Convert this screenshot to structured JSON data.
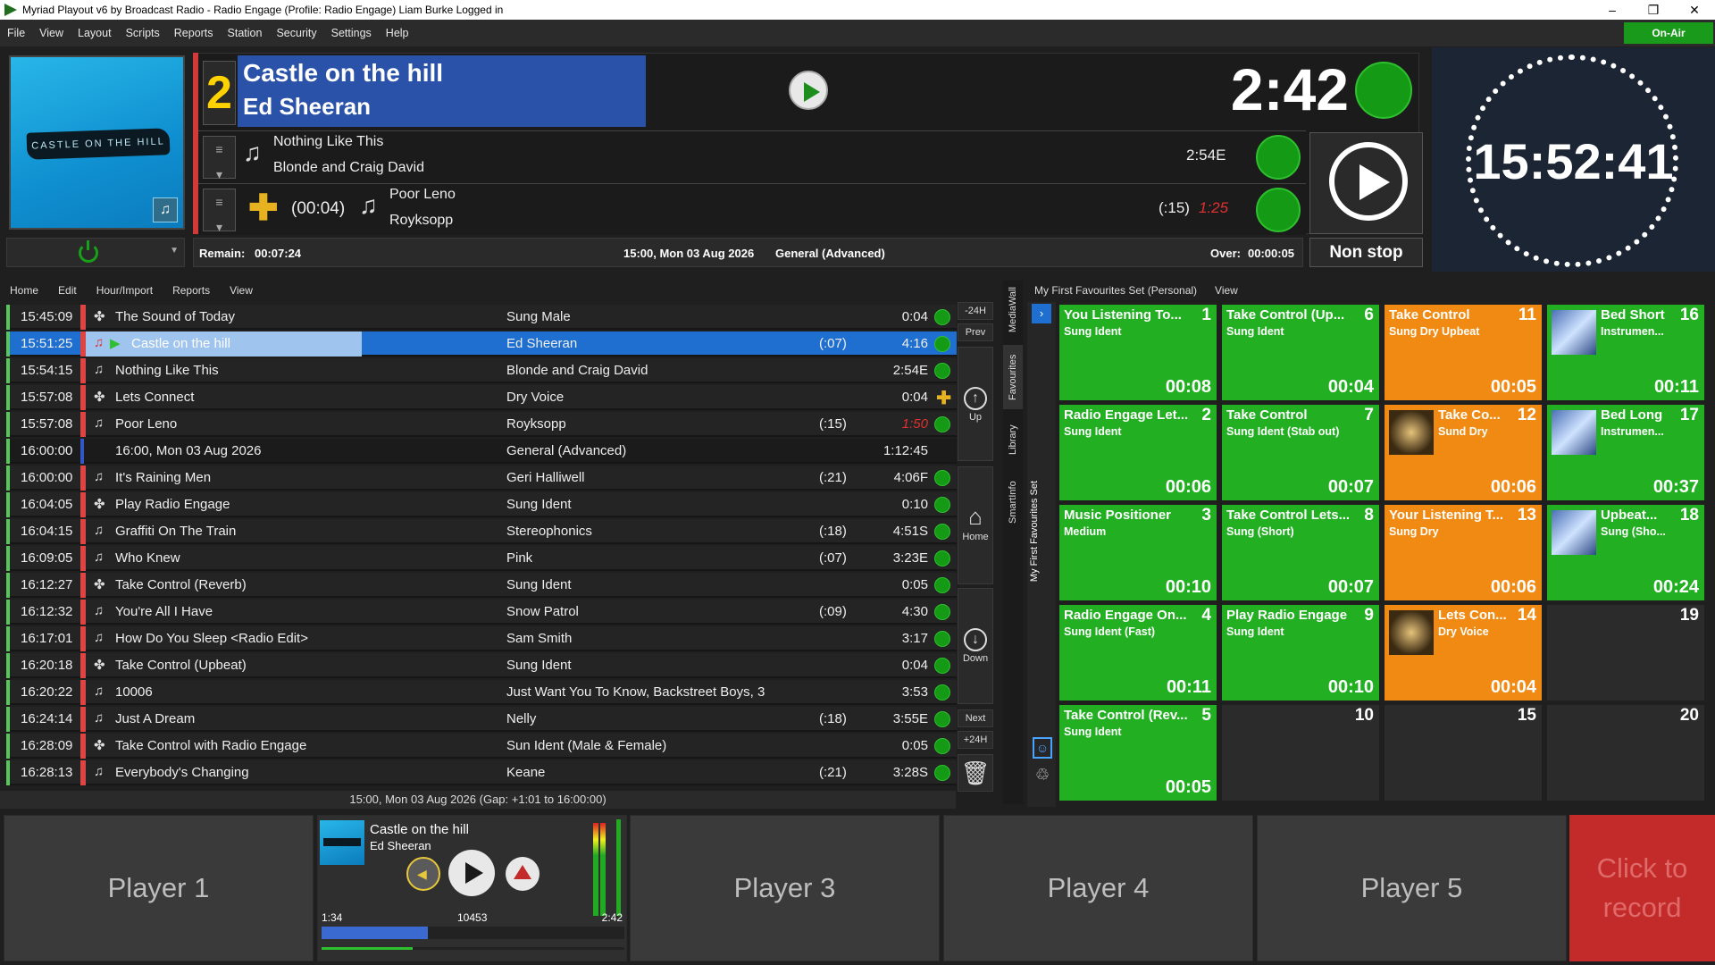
{
  "window": {
    "title": "Myriad Playout v6 by Broadcast Radio - Radio Engage (Profile: Radio Engage) Liam Burke Logged in"
  },
  "menu": [
    "File",
    "View",
    "Layout",
    "Scripts",
    "Reports",
    "Station",
    "Security",
    "Settings",
    "Help"
  ],
  "onair_label": "On-Air",
  "artwork": {
    "text": "CASTLE ON THE HILL"
  },
  "now": {
    "number": "2",
    "title": "Castle on the hill",
    "artist": "Ed Sheeran",
    "countdown": "2:42"
  },
  "next1": {
    "title": "Nothing Like This",
    "artist": "Blonde and Craig David",
    "duration": "2:54E"
  },
  "next2": {
    "intro": "(00:04)",
    "title": "Poor Leno",
    "artist": "Royksopp",
    "intro2": "(:15)",
    "duration": "1:25"
  },
  "info": {
    "remain_label": "Remain:",
    "remain": "00:07:24",
    "date": "15:00, Mon 03 Aug 2026",
    "category": "General (Advanced)",
    "over_label": "Over:",
    "over": "00:00:05"
  },
  "nonstop": "Non stop",
  "clock": "15:52:41",
  "logmenu": [
    "Home",
    "Edit",
    "Hour/Import",
    "Reports",
    "View"
  ],
  "log": [
    {
      "time": "15:45:09",
      "icon": "jingle-icon",
      "title": "The Sound of Today",
      "artist": "Sung Male",
      "intro": "",
      "dur": "0:04",
      "state": "dot"
    },
    {
      "time": "15:51:25",
      "icon": "playing",
      "title": "Castle on the hill",
      "artist": "Ed Sheeran",
      "intro": "(:07)",
      "dur": "4:16",
      "state": "dot"
    },
    {
      "time": "15:54:15",
      "icon": "note",
      "title": "Nothing Like This",
      "artist": "Blonde and Craig David",
      "intro": "",
      "dur": "2:54E",
      "state": "dot"
    },
    {
      "time": "15:57:08",
      "icon": "jingle-icon",
      "title": "Lets Connect",
      "artist": "Dry Voice",
      "intro": "",
      "dur": "0:04",
      "state": "plus"
    },
    {
      "time": "15:57:08",
      "icon": "note",
      "title": "Poor Leno",
      "artist": "Royksopp",
      "intro": "(:15)",
      "dur": "1:50",
      "state": "dot"
    },
    {
      "time": "16:00:00",
      "icon": "hour",
      "title": "16:00, Mon 03 Aug 2026",
      "artist": "General (Advanced)",
      "intro": "",
      "dur": "1:12:45",
      "state": "none"
    },
    {
      "time": "16:00:00",
      "icon": "note",
      "title": "It's Raining Men",
      "artist": "Geri Halliwell",
      "intro": "(:21)",
      "dur": "4:06F",
      "state": "dot"
    },
    {
      "time": "16:04:05",
      "icon": "jingle-icon",
      "title": "Play Radio Engage",
      "artist": "Sung Ident",
      "intro": "",
      "dur": "0:10",
      "state": "dot"
    },
    {
      "time": "16:04:15",
      "icon": "note",
      "title": "Graffiti On The Train",
      "artist": "Stereophonics",
      "intro": "(:18)",
      "dur": "4:51S",
      "state": "dot"
    },
    {
      "time": "16:09:05",
      "icon": "note",
      "title": "Who Knew",
      "artist": "Pink",
      "intro": "(:07)",
      "dur": "3:23E",
      "state": "dot"
    },
    {
      "time": "16:12:27",
      "icon": "jingle-icon",
      "title": "Take Control (Reverb)",
      "artist": "Sung Ident",
      "intro": "",
      "dur": "0:05",
      "state": "dot"
    },
    {
      "time": "16:12:32",
      "icon": "note",
      "title": "You're All I Have",
      "artist": "Snow Patrol",
      "intro": "(:09)",
      "dur": "4:30",
      "state": "dot"
    },
    {
      "time": "16:17:01",
      "icon": "note",
      "title": "How Do You Sleep <Radio Edit>",
      "artist": "Sam Smith",
      "intro": "",
      "dur": "3:17",
      "state": "dot"
    },
    {
      "time": "16:20:18",
      "icon": "jingle-icon",
      "title": "Take Control (Upbeat)",
      "artist": "Sung Ident",
      "intro": "",
      "dur": "0:04",
      "state": "dot"
    },
    {
      "time": "16:20:22",
      "icon": "note",
      "title": "10006",
      "artist": "Just Want You To Know, Backstreet Boys, 3",
      "intro": "",
      "dur": "3:53",
      "state": "dot"
    },
    {
      "time": "16:24:14",
      "icon": "note",
      "title": "Just A Dream",
      "artist": "Nelly",
      "intro": "(:18)",
      "dur": "3:55E",
      "state": "dot"
    },
    {
      "time": "16:28:09",
      "icon": "jingle-icon",
      "title": "Take Control with Radio Engage",
      "artist": "Sun Ident (Male & Female)",
      "intro": "",
      "dur": "0:05",
      "state": "dot"
    },
    {
      "time": "16:28:13",
      "icon": "note",
      "title": "Everybody's Changing",
      "artist": "Keane",
      "intro": "(:21)",
      "dur": "3:28S",
      "state": "dot"
    }
  ],
  "logfooter": "15:00, Mon 03 Aug 2026 (Gap: +1:01 to 16:00:00)",
  "nav": {
    "minus24": "-24H",
    "prev": "Prev",
    "up": "Up",
    "home": "Home",
    "down": "Down",
    "next": "Next",
    "plus24": "+24H"
  },
  "vtabs": [
    "MediaWall",
    "Favourites",
    "Library",
    "SmartInfo"
  ],
  "fav": {
    "header": "My First Favourites Set (Personal)",
    "view": "View",
    "side": "My First Favourites Set",
    "tiles": [
      {
        "n": "1",
        "title": "You Listening To...",
        "sub": "Sung Ident",
        "dur": "00:08",
        "color": "green"
      },
      {
        "n": "6",
        "title": "Take Control (Up...",
        "sub": "Sung Ident",
        "dur": "00:04",
        "color": "green"
      },
      {
        "n": "11",
        "title": "Take Control",
        "sub": "Sung Dry Upbeat",
        "dur": "00:05",
        "color": "orange"
      },
      {
        "n": "16",
        "title": "Bed Short",
        "sub": "Instrumen...",
        "dur": "00:11",
        "color": "green",
        "thumb": "light"
      },
      {
        "n": "2",
        "title": "Radio Engage Let...",
        "sub": "Sung Ident",
        "dur": "00:06",
        "color": "green"
      },
      {
        "n": "7",
        "title": "Take Control",
        "sub": "Sung Ident (Stab out)",
        "dur": "00:07",
        "color": "green"
      },
      {
        "n": "12",
        "title": "Take Co...",
        "sub": "Sund Dry",
        "dur": "00:06",
        "color": "orange",
        "thumb": "dark"
      },
      {
        "n": "17",
        "title": "Bed Long",
        "sub": "Instrumen...",
        "dur": "00:37",
        "color": "green",
        "thumb": "light"
      },
      {
        "n": "3",
        "title": "Music Positioner",
        "sub": "Medium",
        "dur": "00:10",
        "color": "green"
      },
      {
        "n": "8",
        "title": "Take Control Lets...",
        "sub": "Sung (Short)",
        "dur": "00:07",
        "color": "green"
      },
      {
        "n": "13",
        "title": "Your Listening T...",
        "sub": "Sung Dry",
        "dur": "00:06",
        "color": "orange"
      },
      {
        "n": "18",
        "title": "Upbeat...",
        "sub": "Sung (Sho...",
        "dur": "00:24",
        "color": "green",
        "thumb": "light"
      },
      {
        "n": "4",
        "title": "Radio Engage On...",
        "sub": "Sung Ident (Fast)",
        "dur": "00:11",
        "color": "green"
      },
      {
        "n": "9",
        "title": "Play Radio Engage",
        "sub": "Sung Ident",
        "dur": "00:10",
        "color": "green"
      },
      {
        "n": "14",
        "title": "Lets Con...",
        "sub": "Dry Voice",
        "dur": "00:04",
        "color": "orange",
        "thumb": "dark"
      },
      {
        "n": "19",
        "title": "",
        "sub": "",
        "dur": "",
        "color": "empty"
      },
      {
        "n": "5",
        "title": "Take Control (Rev...",
        "sub": "Sung Ident",
        "dur": "00:05",
        "color": "green"
      },
      {
        "n": "10",
        "title": "",
        "sub": "",
        "dur": "",
        "color": "empty"
      },
      {
        "n": "15",
        "title": "",
        "sub": "",
        "dur": "",
        "color": "empty"
      },
      {
        "n": "20",
        "title": "",
        "sub": "",
        "dur": "",
        "color": "empty"
      }
    ]
  },
  "players": {
    "p1": "Player 1",
    "p3": "Player 3",
    "p4": "Player 4",
    "p5": "Player 5",
    "rec": "Click to record"
  },
  "player2": {
    "title": "Castle on the hill",
    "artist": "Ed Sheeran",
    "elapsed": "1:34",
    "mid": "10453",
    "total": "2:42",
    "progress": 0.35,
    "level": 0.3
  }
}
